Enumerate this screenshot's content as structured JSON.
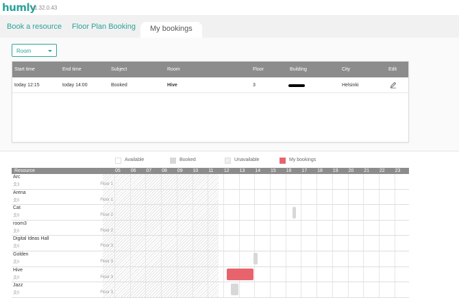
{
  "app": {
    "logo": "humly",
    "version": "v1.32.0.43"
  },
  "tabs": [
    "Book a resource",
    "Floor Plan Booking",
    "My bookings"
  ],
  "filter": {
    "selected": "Room"
  },
  "bookings": {
    "headers": [
      "Start time",
      "End time",
      "Subject",
      "Room",
      "Floor",
      "Building",
      "City",
      "Edit"
    ],
    "row": {
      "start": "today 12:15",
      "end": "today 14:00",
      "subject": "Booked",
      "room": "Hive",
      "floor": "3",
      "city": "Helsinki"
    }
  },
  "legend": [
    {
      "label": "Available",
      "color": "#ffffff"
    },
    {
      "label": "Booked",
      "color": "#d8d8d8"
    },
    {
      "label": "Unavailable",
      "color": "#eeeeee"
    },
    {
      "label": "My bookings",
      "color": "#e8646c"
    }
  ],
  "grid": {
    "resource_label": "Resource",
    "hours": [
      "05",
      "06",
      "07",
      "08",
      "09",
      "10",
      "11",
      "12",
      "13",
      "14",
      "15",
      "16",
      "17",
      "18",
      "19",
      "20",
      "21",
      "22",
      "23"
    ],
    "rows": [
      {
        "name": "Arc",
        "capacity": "3",
        "floor": "Floor 1"
      },
      {
        "name": "Arena",
        "capacity": "0",
        "floor": "Floor 1"
      },
      {
        "name": "Cat",
        "capacity": "0",
        "floor": "Floor 2"
      },
      {
        "name": "room3",
        "capacity": "0",
        "floor": "Floor 2"
      },
      {
        "name": "Digital Ideas Hall",
        "capacity": "0",
        "floor": "Floor 3"
      },
      {
        "name": "Golden",
        "capacity": "0",
        "floor": "Floor 3"
      },
      {
        "name": "Hive",
        "capacity": "0",
        "floor": "Floor 3"
      },
      {
        "name": "Jazz",
        "capacity": "0",
        "floor": "Floor 3"
      }
    ]
  }
}
